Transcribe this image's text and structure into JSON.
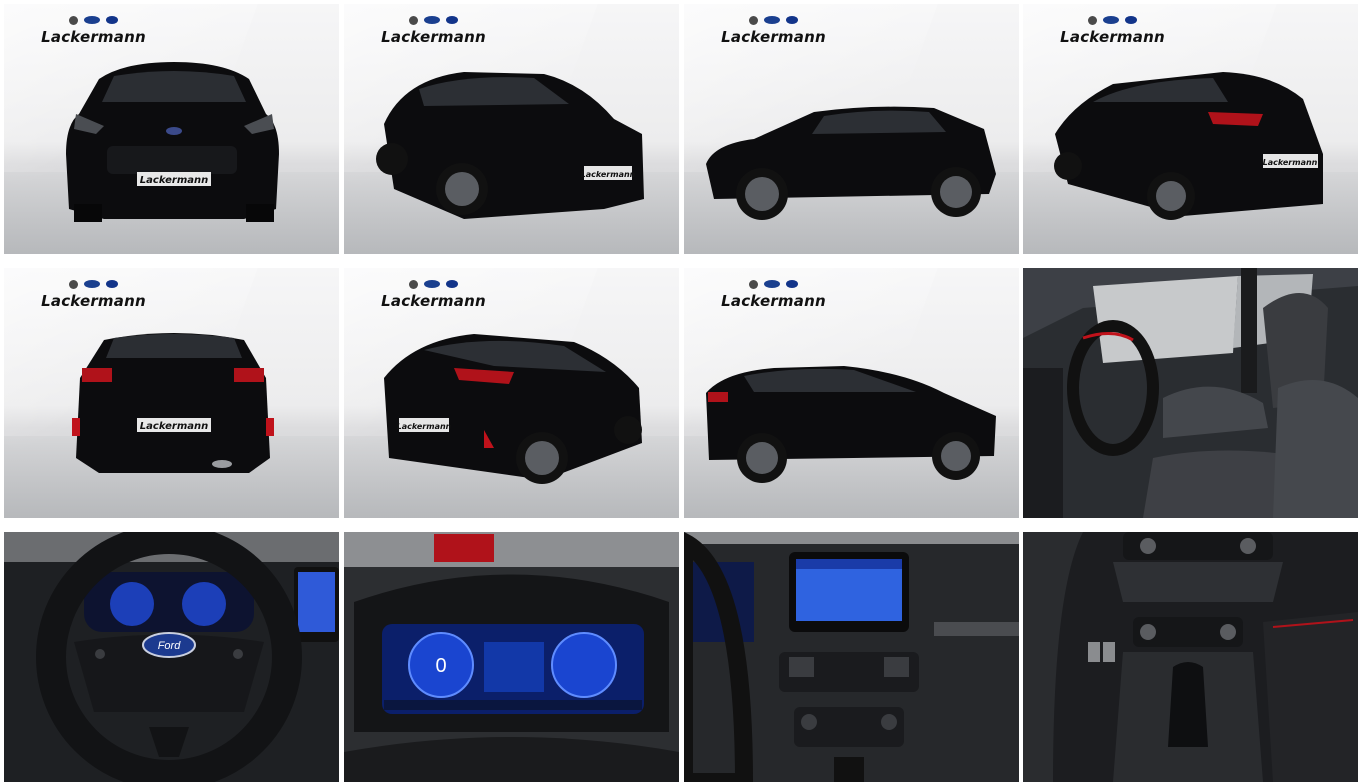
{
  "gallery": {
    "dealer": "Lackermann",
    "brand_icons": [
      "opel-logo-icon",
      "ford-logo-icon",
      "hyundai-logo-icon"
    ],
    "photos": [
      {
        "view": "front"
      },
      {
        "view": "front-three-quarter"
      },
      {
        "view": "side"
      },
      {
        "view": "rear-three-quarter"
      },
      {
        "view": "rear"
      },
      {
        "view": "rear-three-quarter-right"
      },
      {
        "view": "side-rear"
      },
      {
        "view": "interior-front-seats"
      },
      {
        "view": "steering-wheel"
      },
      {
        "view": "instrument-cluster"
      },
      {
        "view": "center-console-display"
      },
      {
        "view": "gear-selector"
      }
    ],
    "steering_badge": "Ford",
    "cluster_speed": "0"
  },
  "colors": {
    "car_paint": "#0b0b0d",
    "accent_red": "#c0121b",
    "display_blue": "#1f4fd8"
  }
}
